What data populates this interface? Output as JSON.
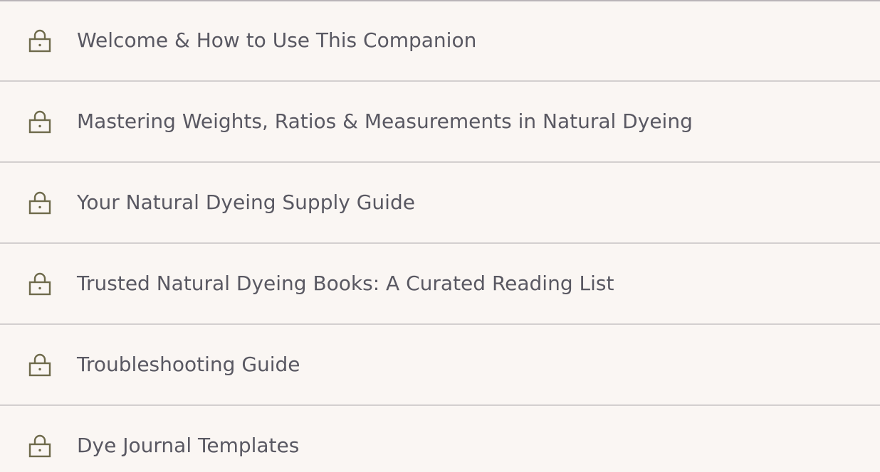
{
  "lessons": [
    {
      "title": "Welcome & How to Use This Companion",
      "icon": "lock-icon"
    },
    {
      "title": "Mastering Weights, Ratios & Measurements in Natural Dyeing",
      "icon": "lock-icon"
    },
    {
      "title": "Your Natural Dyeing Supply Guide",
      "icon": "lock-icon"
    },
    {
      "title": "Trusted Natural Dyeing Books: A Curated Reading List",
      "icon": "lock-icon"
    },
    {
      "title": "Troubleshooting Guide",
      "icon": "lock-icon"
    },
    {
      "title": "Dye Journal Templates",
      "icon": "lock-icon"
    }
  ],
  "colors": {
    "background": "#faf6f3",
    "text": "#595862",
    "icon": "#6e6a4b",
    "divider": "#d3cfcf"
  }
}
